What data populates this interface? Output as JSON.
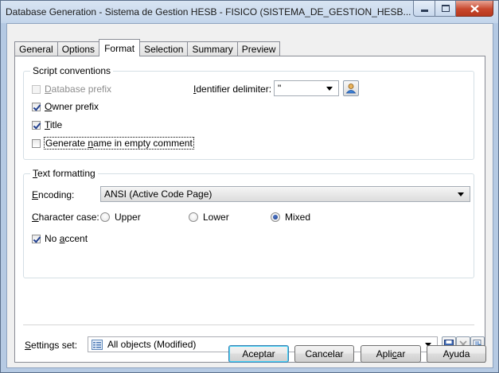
{
  "window": {
    "title": "Database Generation - Sistema de Gestion HESB - FISICO (SISTEMA_DE_GESTION_HESB..."
  },
  "tabs": [
    {
      "label": "General"
    },
    {
      "label": "Options"
    },
    {
      "label": "Format",
      "active": true
    },
    {
      "label": "Selection"
    },
    {
      "label": "Summary"
    },
    {
      "label": "Preview"
    }
  ],
  "script_conventions": {
    "title": "Script conventions",
    "database_prefix": {
      "label_u": "D",
      "label_rest": "atabase prefix",
      "checked": false,
      "enabled": false
    },
    "owner_prefix": {
      "label_u": "O",
      "label_rest": "wner prefix",
      "checked": true
    },
    "title_cb": {
      "label_u": "T",
      "label_rest": "itle",
      "checked": true
    },
    "generate_name": {
      "label_pre": "Generate ",
      "label_u": "n",
      "label_rest": "ame in empty comment",
      "checked": false
    },
    "identifier_delimiter": {
      "label_u": "I",
      "label_rest": "dentifier delimiter:",
      "value": "\""
    }
  },
  "text_formatting": {
    "title_u": "T",
    "title_rest": "ext formatting",
    "encoding": {
      "label_u": "E",
      "label_rest": "ncoding:",
      "value": "ANSI (Active Code Page)"
    },
    "character_case": {
      "label_u": "C",
      "label_rest": "haracter case:",
      "options": [
        "Upper",
        "Lower",
        "Mixed"
      ],
      "selected": "Mixed"
    },
    "no_accent": {
      "label_pre": "No ",
      "label_u": "a",
      "label_rest": "ccent",
      "checked": true
    }
  },
  "settings_set": {
    "label_u": "S",
    "label_rest": "ettings set:",
    "value": "All objects (Modified)"
  },
  "buttons": {
    "accept": "Aceptar",
    "cancel": "Cancelar",
    "apply_pre": "Apli",
    "apply_u": "c",
    "apply_rest": "ar",
    "help": "Ayuda"
  },
  "icons": {
    "caption_minimize": "minimize-icon",
    "caption_maximize": "maximize-icon",
    "caption_close": "close-icon",
    "delimiter_picker": "user-picker-icon",
    "settings_list": "list-icon",
    "save": "save-icon",
    "delete": "delete-icon",
    "properties": "properties-icon"
  }
}
